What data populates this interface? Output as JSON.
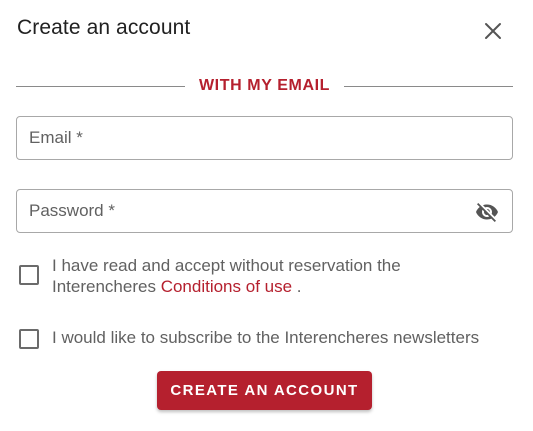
{
  "dialog": {
    "title": "Create an account",
    "close_icon": "close-icon"
  },
  "section": {
    "label": "WITH MY EMAIL"
  },
  "form": {
    "email": {
      "placeholder": "Email *",
      "value": ""
    },
    "password": {
      "placeholder": "Password *",
      "value": "",
      "toggle_icon": "eye-off-icon"
    }
  },
  "terms": {
    "checked": false,
    "text_before": "I have read and accept without reservation the Interencheres",
    "link_label": "Conditions of use",
    "text_after": "."
  },
  "newsletter": {
    "checked": false,
    "label": "I would like to subscribe to the Interencheres newsletters"
  },
  "submit": {
    "label": "CREATE AN ACCOUNT"
  },
  "colors": {
    "accent": "#b5202e",
    "text": "#212121",
    "muted": "#616161",
    "border": "#a8a8a8"
  }
}
